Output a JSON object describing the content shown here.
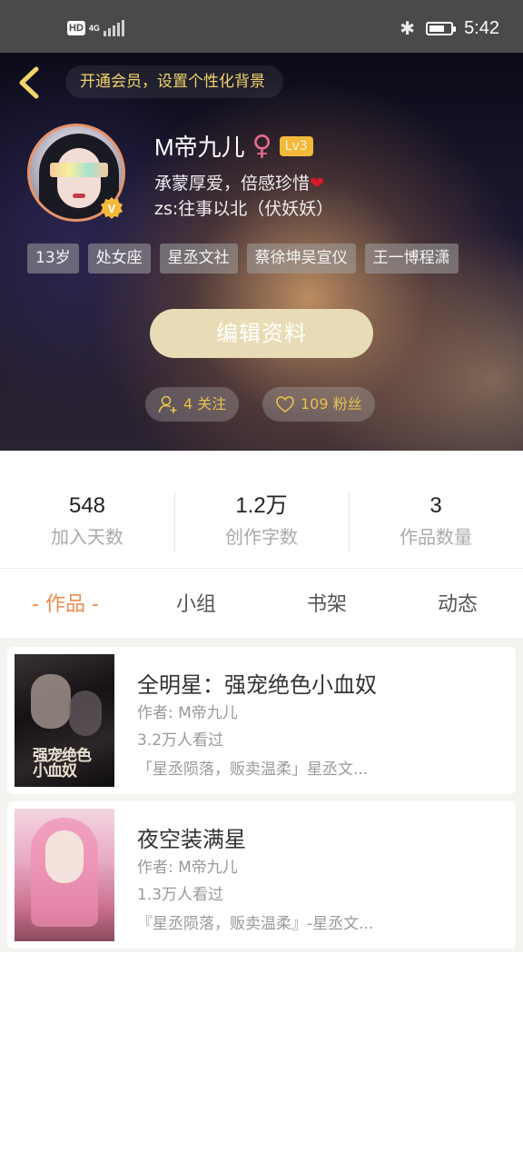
{
  "status_bar": {
    "hd": "HD",
    "network": "4G",
    "time": "5:42"
  },
  "header": {
    "vip_banner": "开通会员，设置个性化背景",
    "name": "M帝九儿",
    "gender_symbol": "♀",
    "level": "Lv3",
    "bio_line1": "承蒙厚爱，倍感珍惜",
    "bio_heart": "❤",
    "bio_line2": "zs:往事以北（伏妖妖）",
    "tags": [
      "13岁",
      "处女座",
      "星丞文社",
      "蔡徐坤吴宣仪",
      "王一博程潇"
    ],
    "edit_button": "编辑资料",
    "following": "4 关注",
    "followers": "109 粉丝"
  },
  "stats": [
    {
      "value": "548",
      "label": "加入天数"
    },
    {
      "value": "1.2万",
      "label": "创作字数"
    },
    {
      "value": "3",
      "label": "作品数量"
    }
  ],
  "tabs": [
    {
      "label": "作品",
      "active": true
    },
    {
      "label": "小组"
    },
    {
      "label": "书架"
    },
    {
      "label": "动态"
    }
  ],
  "tab_active_marker": "-",
  "works": [
    {
      "title": "全明星：强宠绝色小血奴",
      "author": "作者: M帝九儿",
      "views": "3.2万人看过",
      "tagline": "「星丞陨落，贩卖温柔」星丞文...",
      "cover_text": "强宠绝色小血奴"
    },
    {
      "title": "夜空装满星",
      "author": "作者: M帝九儿",
      "views": "1.3万人看过",
      "tagline": "『星丞陨落，贩卖温柔』-星丞文..."
    }
  ],
  "colors": {
    "accent": "#ef8a4e",
    "vip_text": "#f3d46b",
    "level_badge": "#f2b93a",
    "follow_text": "#e9c24c"
  }
}
